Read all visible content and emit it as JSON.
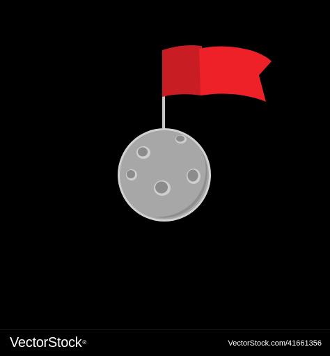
{
  "illustration": {
    "subject": "moon with red flag",
    "colors": {
      "background": "#000000",
      "flag_dark": "#c81d22",
      "flag_light": "#ee2129",
      "pole": "#c6c6c6",
      "moon_body": "#a7a7a7",
      "moon_shadow": "#8f8f8f",
      "moon_outline": "#d2d2d2",
      "crater": "#8c8c8c",
      "crater_rim": "#cfcfcf"
    }
  },
  "footer": {
    "brand": "VectorStock",
    "brand_mark": "®",
    "credit": "VectorStock.com/41661356"
  }
}
